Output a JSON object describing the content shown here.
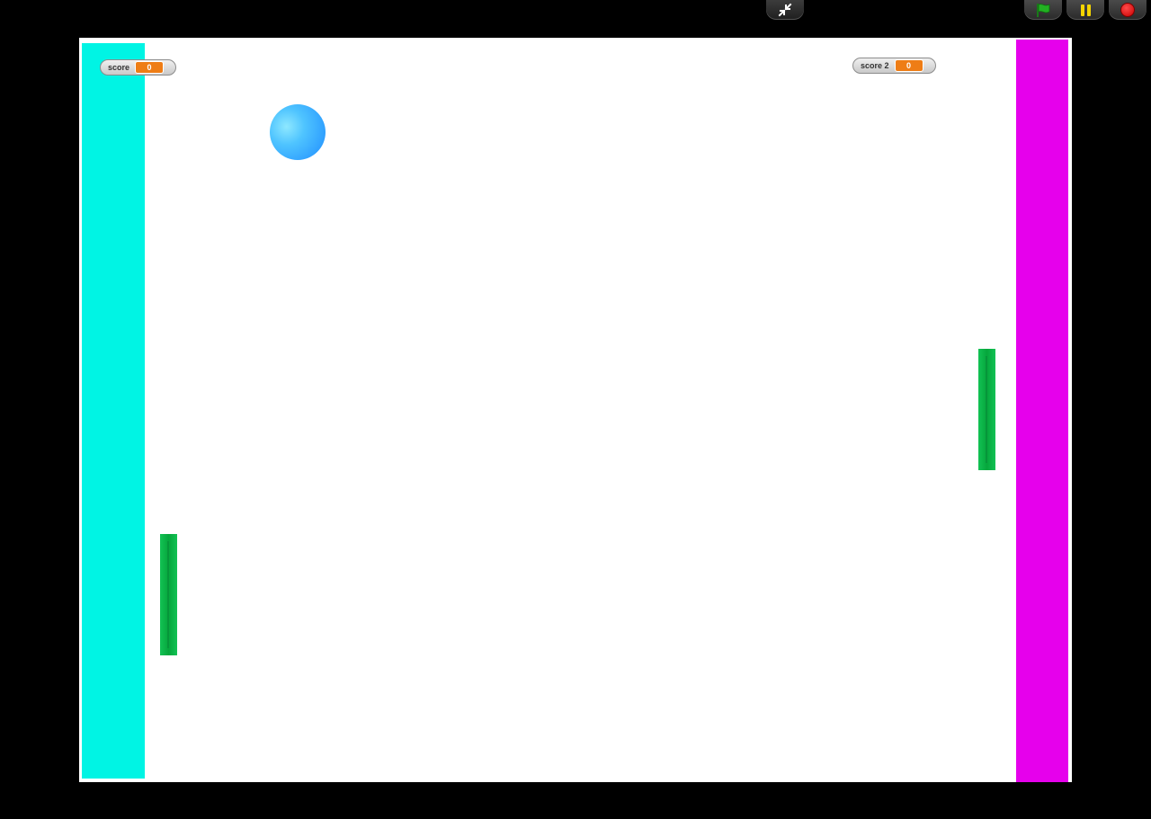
{
  "controls": {
    "exit_fullscreen_icon": "shrink-arrows-icon",
    "green_flag_icon": "green-flag-icon",
    "pause_icon": "pause-icon",
    "stop_icon": "stop-icon",
    "flag_color": "#22b122",
    "pause_color": "#f4d400",
    "stop_color": "#d40000"
  },
  "stage": {
    "background_color": "#ffffff",
    "left_wall_color": "#00f4e4",
    "right_wall_color": "#e600ec",
    "paddle_color": "#12c254",
    "ball_color": "#3aa8ff"
  },
  "monitors": {
    "score": {
      "label": "score",
      "value": "0"
    },
    "score2": {
      "label": "score 2",
      "value": "0"
    }
  }
}
